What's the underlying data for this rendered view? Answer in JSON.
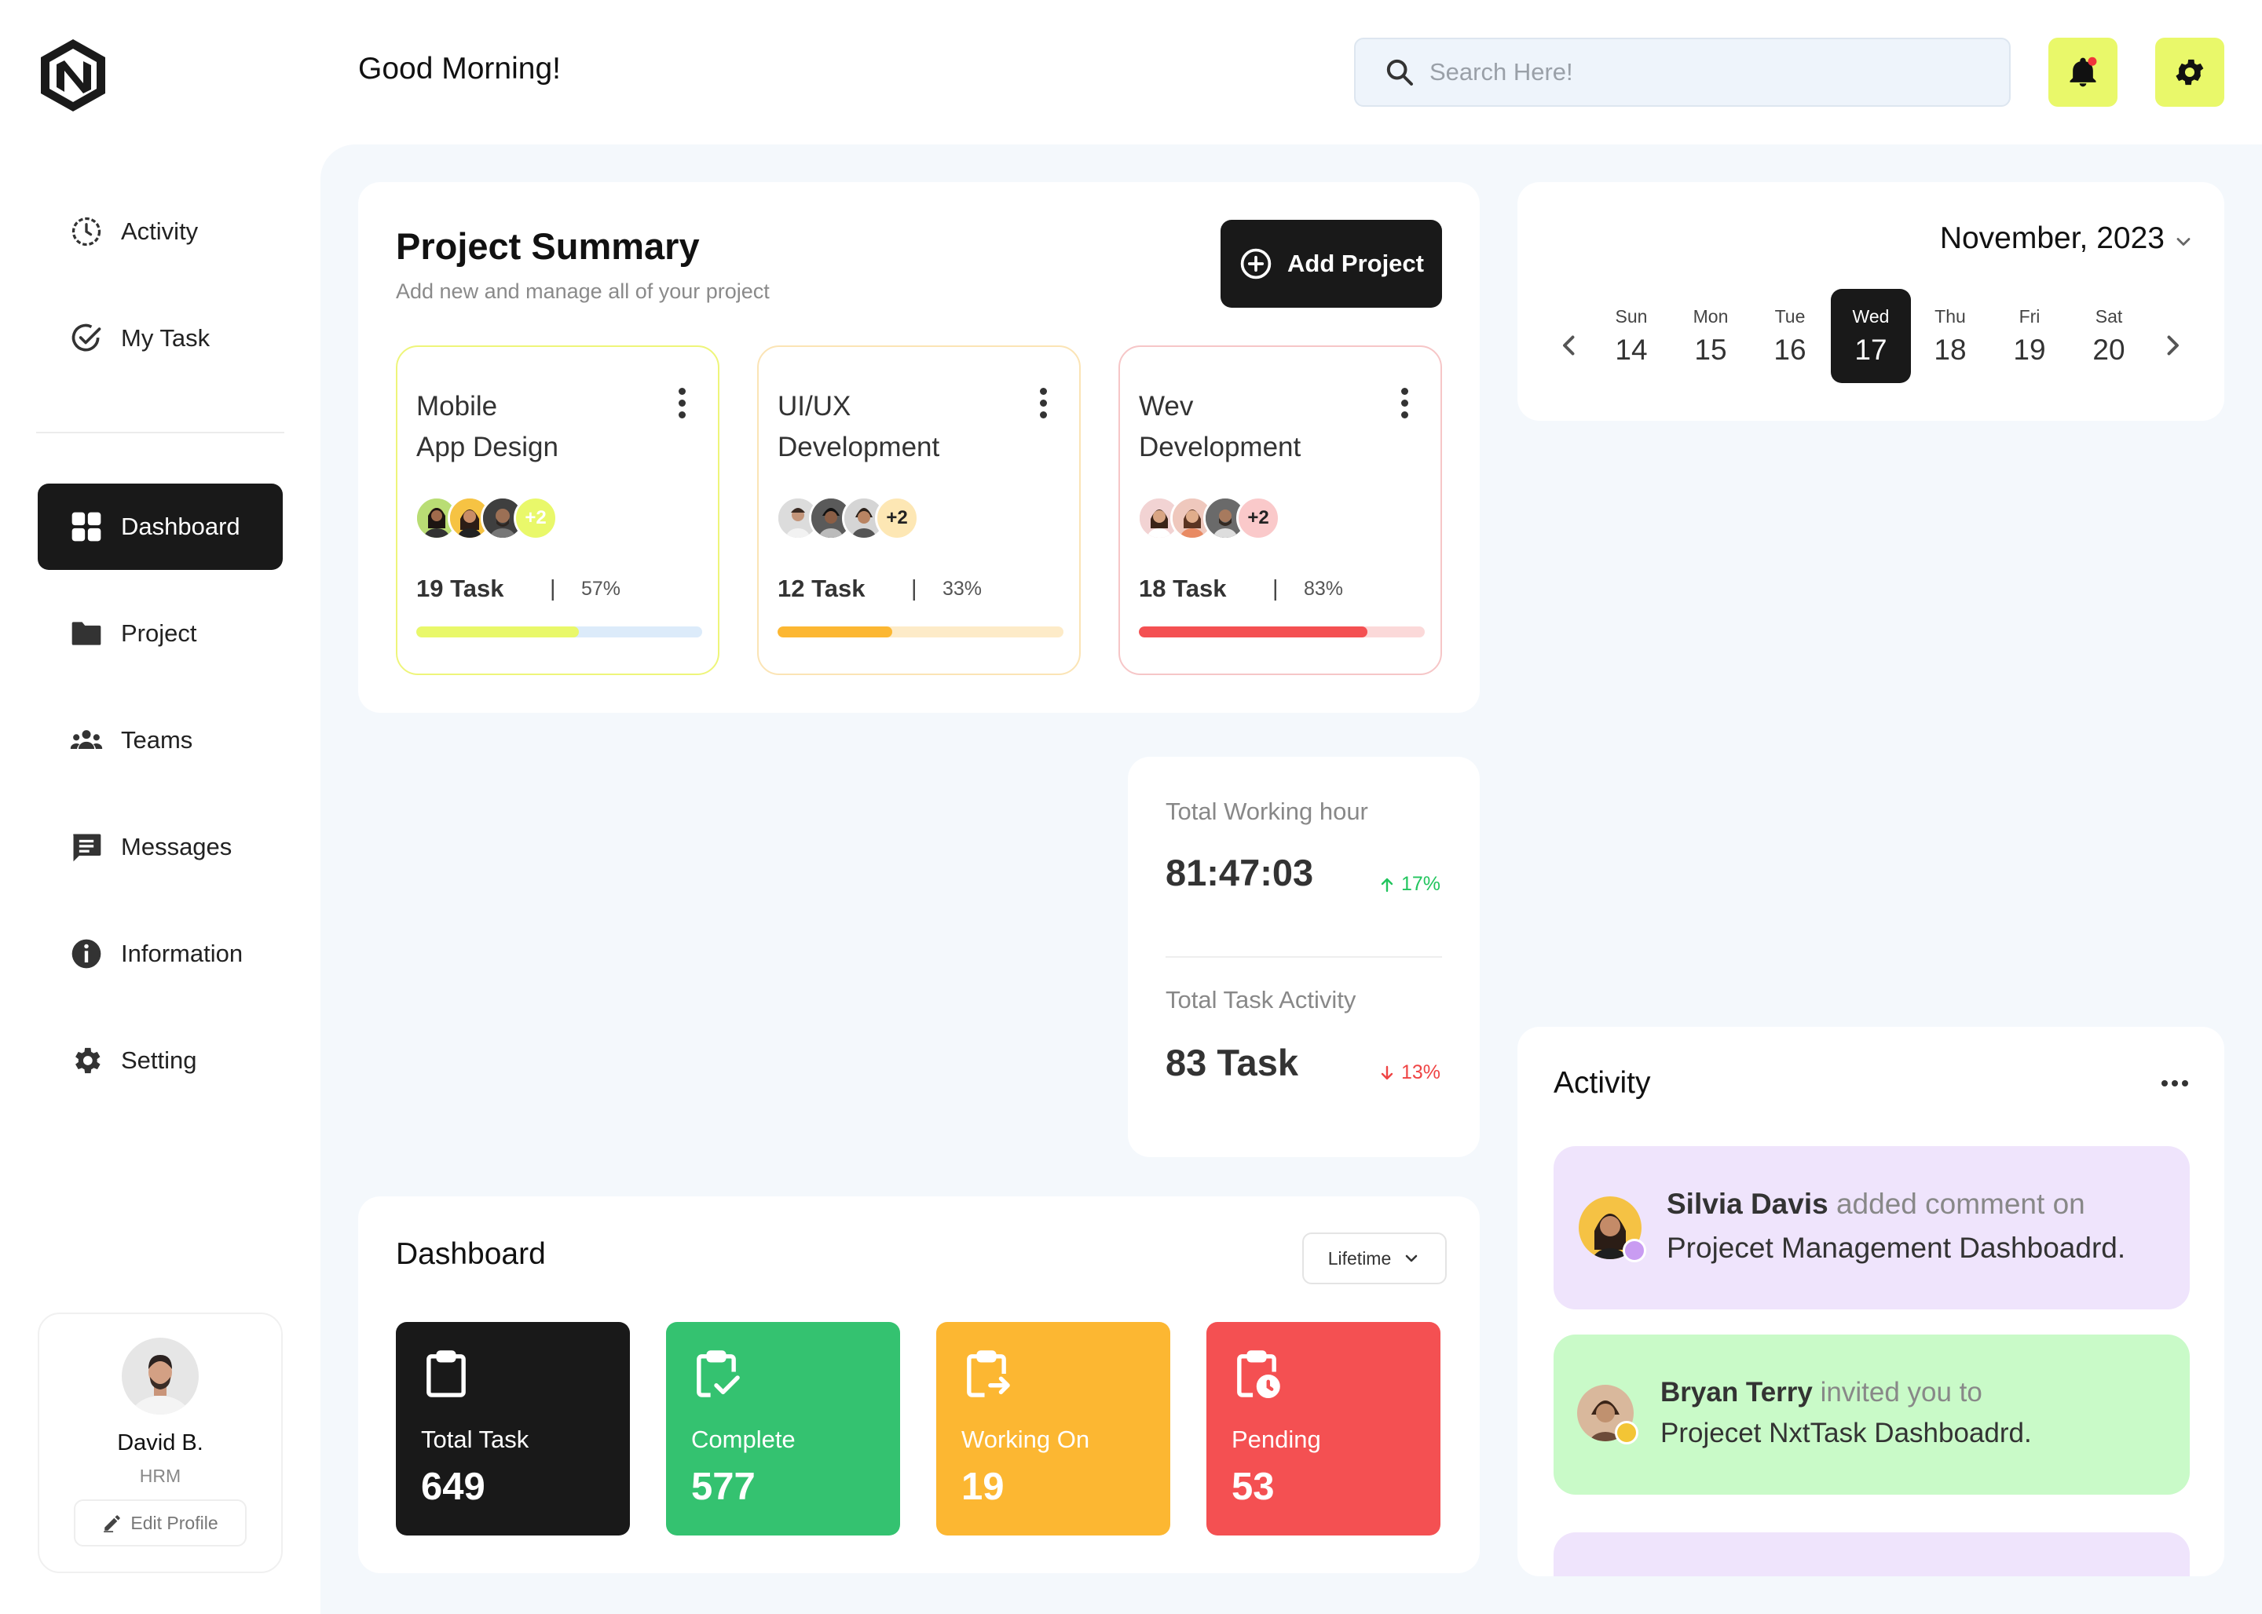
{
  "header": {
    "greeting": "Good Morning!",
    "search_placeholder": "Search Here!"
  },
  "sidebar": {
    "items": [
      {
        "label": "Activity",
        "icon": "clock-icon"
      },
      {
        "label": "My Task",
        "icon": "check-circle-icon"
      },
      {
        "label": "Dashboard",
        "icon": "grid-icon",
        "active": true
      },
      {
        "label": "Project",
        "icon": "folder-icon"
      },
      {
        "label": "Teams",
        "icon": "people-icon"
      },
      {
        "label": "Messages",
        "icon": "chat-icon"
      },
      {
        "label": "Information",
        "icon": "info-icon"
      },
      {
        "label": "Setting",
        "icon": "gear-icon"
      }
    ]
  },
  "profile": {
    "name": "David B.",
    "role": "HRM",
    "edit_label": "Edit Profile"
  },
  "project_summary": {
    "title": "Project Summary",
    "subtitle": "Add new and manage all of your project",
    "add_label": "Add Project",
    "projects": [
      {
        "title_line1": "Mobile",
        "title_line2": "App Design",
        "extra": "+2",
        "tasks": "19 Task",
        "sep": "|",
        "percent": "57%",
        "progress": 0.57,
        "accent": "#e9f86a",
        "track": "#dcebfa",
        "border": "#eef57a"
      },
      {
        "title_line1": "UI/UX",
        "title_line2": "Development",
        "extra": "+2",
        "tasks": "12 Task",
        "sep": "|",
        "percent": "33%",
        "progress": 0.4,
        "accent": "#fcb732",
        "track": "#fdebc8",
        "border": "#fbe4b5"
      },
      {
        "title_line1": "Wev",
        "title_line2": "Development",
        "extra": "+2",
        "tasks": "18 Task",
        "sep": "|",
        "percent": "83%",
        "progress": 0.8,
        "accent": "#f45052",
        "track": "#fbd9d9",
        "border": "#f6c6c7"
      }
    ]
  },
  "calendar": {
    "month": "November, 2023",
    "days": [
      {
        "dow": "Sun",
        "num": "14"
      },
      {
        "dow": "Mon",
        "num": "15"
      },
      {
        "dow": "Tue",
        "num": "16"
      },
      {
        "dow": "Wed",
        "num": "17",
        "selected": true
      },
      {
        "dow": "Thu",
        "num": "18"
      },
      {
        "dow": "Fri",
        "num": "19"
      },
      {
        "dow": "Sat",
        "num": "20"
      }
    ]
  },
  "stats": {
    "working_hour_label": "Total Working hour",
    "working_hour_value": "81:47:03",
    "working_hour_trend": "17%",
    "task_activity_label": "Total Task Activity",
    "task_activity_value": "83 Task",
    "task_activity_trend": "13%",
    "up_color": "#22c55e",
    "down_color": "#ef4444"
  },
  "dashboard": {
    "title": "Dashboard",
    "filter": "Lifetime",
    "tiles": [
      {
        "label": "Total Task",
        "value": "649",
        "color": "#191919",
        "icon": "clipboard-icon"
      },
      {
        "label": "Complete",
        "value": "577",
        "color": "#34c270",
        "icon": "clipboard-check-icon"
      },
      {
        "label": "Working On",
        "value": "19",
        "color": "#fcb732",
        "icon": "clipboard-arrow-icon"
      },
      {
        "label": "Pending",
        "value": "53",
        "color": "#f45052",
        "icon": "clipboard-clock-icon"
      }
    ]
  },
  "activity": {
    "title": "Activity",
    "items": [
      {
        "name": "Silvia Davis",
        "action": "added comment on",
        "target": "Projecet Management Dashboadrd.",
        "bg": "#efe4fc",
        "badge": "#c99cf2"
      },
      {
        "name": "Bryan Terry",
        "action": "invited you to",
        "target": "Projecet NxtTask Dashboadrd.",
        "bg": "#c9fac8",
        "badge": "#f3c535"
      }
    ]
  }
}
